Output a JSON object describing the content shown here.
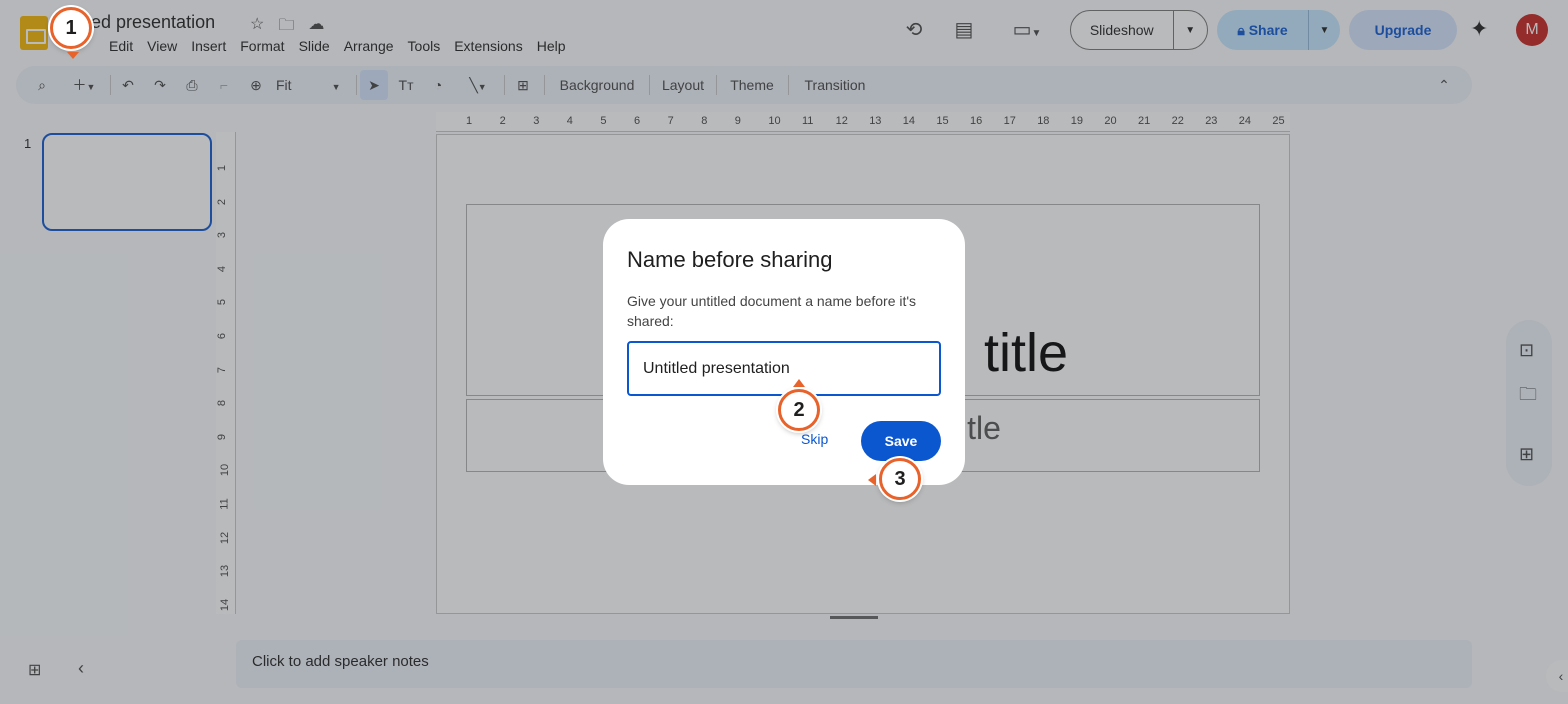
{
  "header": {
    "doc_title": "Untitled presentation",
    "doc_title_visible": "tled presentation",
    "menu": [
      "Edit",
      "View",
      "Insert",
      "Format",
      "Slide",
      "Arrange",
      "Tools",
      "Extensions",
      "Help"
    ],
    "slideshow_label": "Slideshow",
    "share_label": "Share",
    "upgrade_label": "Upgrade",
    "avatar_initial": "M"
  },
  "toolbar": {
    "zoom_label": "Fit",
    "background_label": "Background",
    "layout_label": "Layout",
    "theme_label": "Theme",
    "transition_label": "Transition"
  },
  "slides_panel": {
    "slide_number": "1"
  },
  "ruler": {
    "horizontal": [
      "1",
      "2",
      "3",
      "4",
      "5",
      "6",
      "7",
      "8",
      "9",
      "10",
      "11",
      "12",
      "13",
      "14",
      "15",
      "16",
      "17",
      "18",
      "19",
      "20",
      "21",
      "22",
      "23",
      "24",
      "25"
    ],
    "vertical": [
      "1",
      "2",
      "3",
      "4",
      "5",
      "6",
      "7",
      "8",
      "9",
      "10",
      "11",
      "12",
      "13",
      "14"
    ]
  },
  "slide": {
    "title_fragment": "title",
    "subtitle_fragment": "itle"
  },
  "notes": {
    "placeholder": "Click to add speaker notes"
  },
  "dialog": {
    "title": "Name before sharing",
    "description": "Give your untitled document a name before it's shared:",
    "input_value": "Untitled presentation",
    "skip_label": "Skip",
    "save_label": "Save"
  },
  "annotations": [
    "1",
    "2",
    "3"
  ],
  "colors": {
    "accent": "#0b57d0",
    "marker_border": "#e8632b",
    "share_bg": "#c2e7ff",
    "upgrade_bg": "#d3e3fd",
    "logo": "#f4b400",
    "avatar": "#c5221f"
  }
}
